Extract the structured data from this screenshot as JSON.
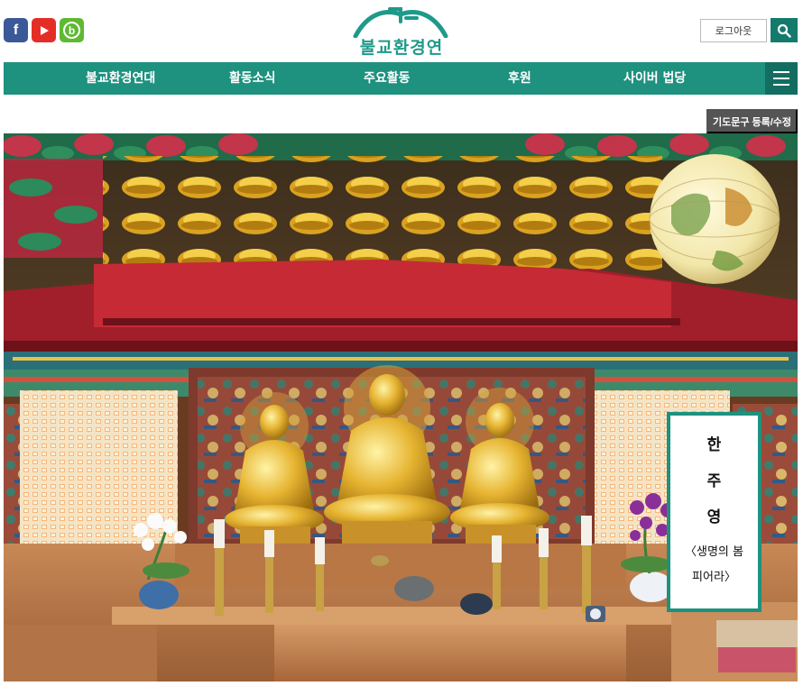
{
  "header": {
    "social": [
      {
        "name": "facebook",
        "icon": "facebook-icon",
        "glyph": "f",
        "color": "#3b5998"
      },
      {
        "name": "youtube",
        "icon": "youtube-icon",
        "glyph": "",
        "color": "#e52d27"
      },
      {
        "name": "blog",
        "icon": "blog-icon",
        "glyph": "b",
        "color": "#5fb932"
      }
    ],
    "logo_text": "불교환경연대",
    "logout_label": "로그아웃",
    "search_icon": "search-icon"
  },
  "nav": {
    "items": [
      "불교환경연대",
      "활동소식",
      "주요활동",
      "후원",
      "사이버 법당"
    ],
    "menu_icon": "hamburger-menu-icon"
  },
  "prayer_button_label": "기도문구 등록/수정",
  "verse": {
    "line1": "한",
    "line2": "주",
    "line3": "영",
    "line4": "〈생명의 봄",
    "line5": "피어라〉"
  },
  "colors": {
    "brand": "#1e917f",
    "brand_dark": "#136d60",
    "search": "#147a6c",
    "prayer_button": "#555555"
  }
}
